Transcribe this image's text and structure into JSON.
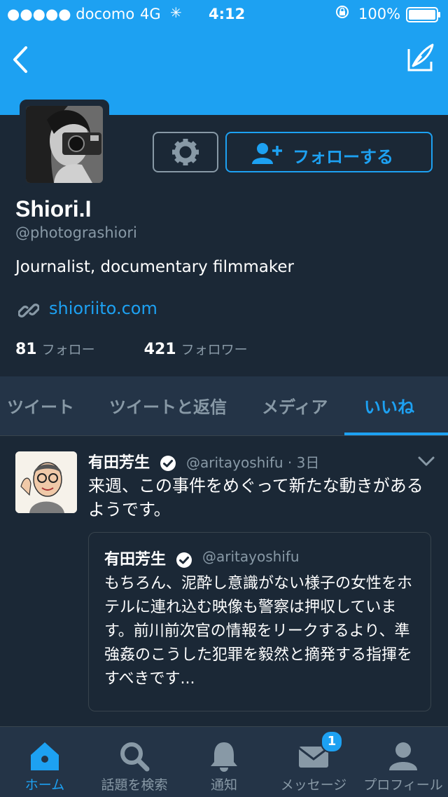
{
  "status_bar": {
    "carrier": "●●●●● docomo",
    "network": "4G",
    "time": "4:12",
    "battery": "100%"
  },
  "colors": {
    "accent": "#1da1f2",
    "background": "#1b2836",
    "bar": "#243447",
    "muted": "#8899a6"
  },
  "profile": {
    "name": "Shiori.I",
    "handle": "@photograshiori",
    "bio": "Journalist, documentary filmmaker",
    "link": "shioriito.com",
    "following_count": "81",
    "following_label": "フォロー",
    "followers_count": "421",
    "followers_label": "フォロワー",
    "follow_button": "フォローする"
  },
  "tabs": [
    {
      "label": "ツイート"
    },
    {
      "label": "ツイートと返信"
    },
    {
      "label": "メディア"
    },
    {
      "label": "いいね",
      "active": true
    }
  ],
  "tweet": {
    "author": "有田芳生",
    "meta": "@aritayoshifu · 3日",
    "text": "来週、この事件をめぐって新たな動きがあるようです。",
    "quote": {
      "author": "有田芳生",
      "handle": "@aritayoshifu",
      "text": "もちろん、泥酔し意識がない様子の女性をホテルに連れ込む映像も警察は押収しています。前川前次官の情報をリークするより、準強姦のこうした犯罪を毅然と摘発する指揮をすべきです..."
    }
  },
  "bottom_nav": [
    {
      "label": "ホーム",
      "icon": "home-icon",
      "active": true
    },
    {
      "label": "話題を検索",
      "icon": "search-icon"
    },
    {
      "label": "通知",
      "icon": "bell-icon"
    },
    {
      "label": "メッセージ",
      "icon": "mail-icon",
      "badge": "1"
    },
    {
      "label": "プロフィール",
      "icon": "person-icon"
    }
  ]
}
